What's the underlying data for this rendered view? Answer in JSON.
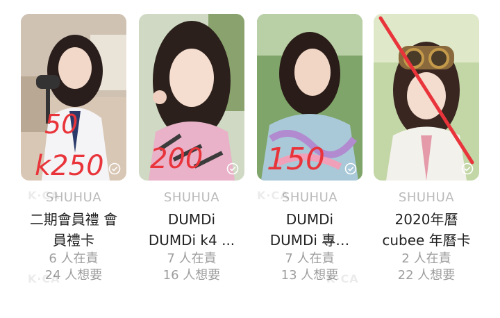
{
  "cards": [
    {
      "member": "SHUHUA",
      "name_line1": "二期會員禮 會",
      "name_line2": "員禮卡",
      "owners": "6 人在責",
      "wants": "24 人想要",
      "handwriting": "50 k250",
      "accent_color": "#e8343a"
    },
    {
      "member": "SHUHUA",
      "name_line1": "DUMDi",
      "name_line2": "DUMDi k4 ...",
      "owners": "7 人在責",
      "wants": "16 人想要",
      "handwriting": "200",
      "accent_color": "#e8343a"
    },
    {
      "member": "SHUHUA",
      "name_line1": "DUMDi",
      "name_line2": "DUMDi 專…",
      "owners": "7 人在責",
      "wants": "13 人想要",
      "handwriting": "150",
      "accent_color": "#e8343a"
    },
    {
      "member": "SHUHUA",
      "name_line1": "2020年曆",
      "name_line2": "cubee 年曆卡",
      "owners": "2 人在責",
      "wants": "22 人想要",
      "handwriting": "crossed out",
      "accent_color": "#e8343a"
    }
  ],
  "watermark": "K·CA",
  "icons": [
    "check-circle-icon"
  ]
}
